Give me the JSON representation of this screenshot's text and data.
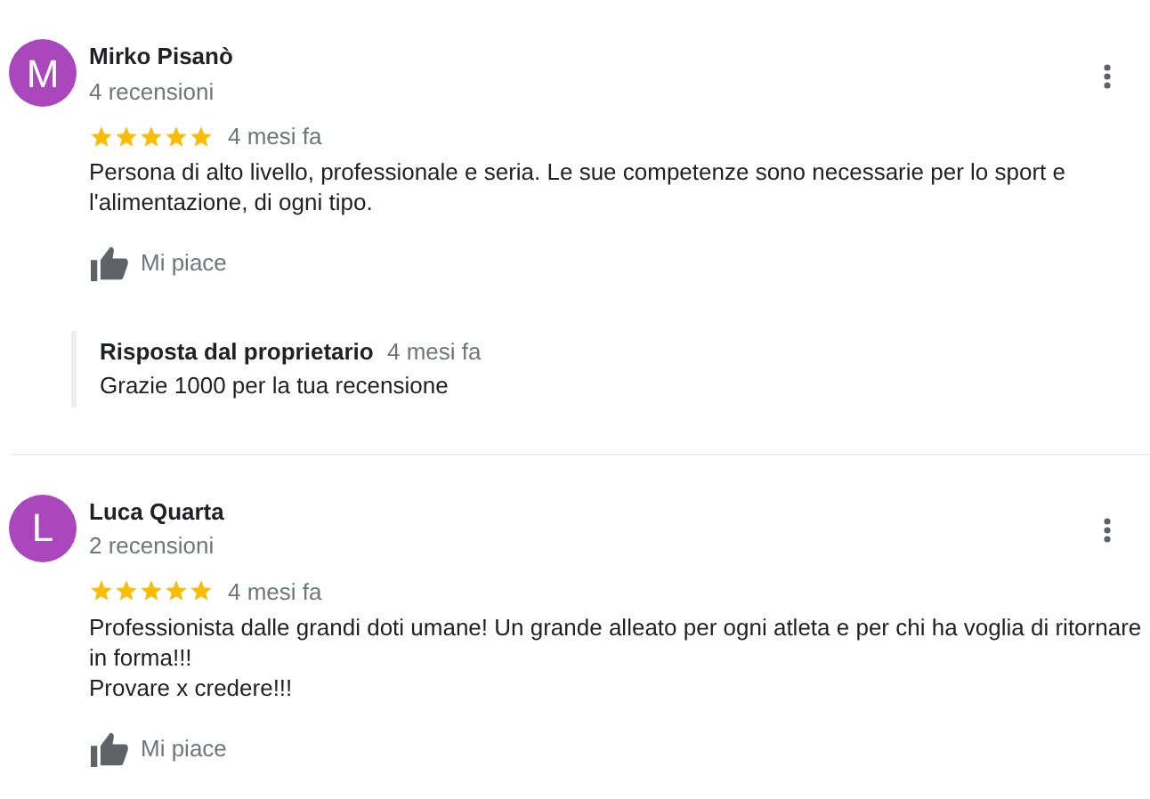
{
  "reviews": [
    {
      "initial": "M",
      "author": "Mirko Pisanò",
      "review_count": "4 recensioni",
      "stars": 5,
      "date": "4 mesi fa",
      "text": "Persona di alto livello, professionale e seria. Le sue competenze sono necessarie per lo sport e l'alimentazione, di ogni tipo.",
      "like_label": "Mi piace",
      "owner_reply": {
        "title": "Risposta dal proprietario",
        "date": "4 mesi fa",
        "text": "Grazie 1000 per la tua recensione"
      }
    },
    {
      "initial": "L",
      "author": "Luca Quarta",
      "review_count": "2 recensioni",
      "stars": 5,
      "date": "4 mesi fa",
      "text": "Professionista dalle grandi doti umane! Un grande alleato per ogni atleta e per chi ha voglia di ritornare in forma!!!\nProvare x credere!!!",
      "like_label": "Mi piace"
    }
  ]
}
